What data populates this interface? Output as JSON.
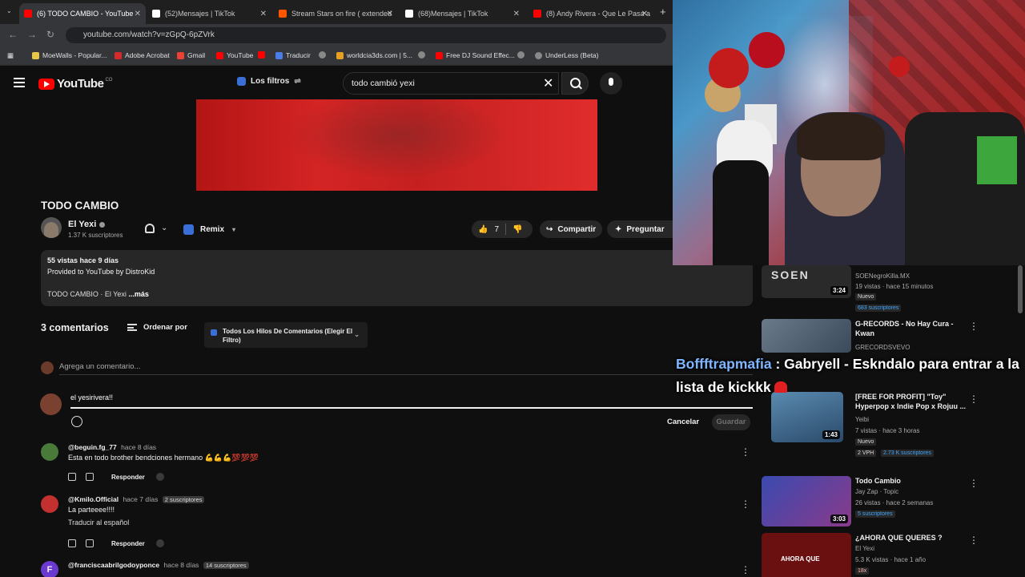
{
  "browser": {
    "tabs": [
      {
        "label": "(6) TODO CAMBIO - YouTube",
        "active": true,
        "icon": "youtube-icon",
        "color": "#ff0000"
      },
      {
        "label": "(52)Mensajes | TikTok",
        "active": false,
        "icon": "tiktok-icon",
        "color": "#ffffff"
      },
      {
        "label": "Stream Stars on fire ( extended",
        "active": false,
        "icon": "soundcloud-icon",
        "color": "#ff5500"
      },
      {
        "label": "(68)Mensajes | TikTok",
        "active": false,
        "icon": "tiktok-icon",
        "color": "#ffffff"
      },
      {
        "label": "(8) Andy Rivera - Que Le Pasa a",
        "active": false,
        "icon": "youtube-icon",
        "color": "#ff0000"
      }
    ],
    "url": "youtube.com/watch?v=zGpQ-6pZVrk",
    "bookmarks": [
      {
        "label": "MoeWalls - Popular...",
        "color": "#e8c548"
      },
      {
        "label": "Adobe Acrobat",
        "color": "#d42a2a"
      },
      {
        "label": "Gmail",
        "color": "#ea4335"
      },
      {
        "label": "YouTube",
        "color": "#ff0000"
      },
      {
        "label": "Traducir",
        "color": "#4a7de8"
      },
      {
        "label": "worldcia3ds.com | 5...",
        "color": "#e8a020"
      },
      {
        "label": "Free DJ Sound Effec...",
        "color": "#ff0000"
      },
      {
        "label": "UnderLess (Beta)",
        "color": "#888888"
      }
    ]
  },
  "header": {
    "logo": "YouTube",
    "logo_suffix": "CO",
    "filters_label": "Los filtros",
    "search_value": "todo cambió yexi"
  },
  "video": {
    "title": "TODO CAMBIO",
    "channel": "El Yexi",
    "subscribers": "1.37 K suscriptores",
    "remix_label": "Remix",
    "likes": "7",
    "share_label": "Compartir",
    "ask_label": "Preguntar"
  },
  "description": {
    "stats": "55 vistas  hace 9 días",
    "provided": "Provided to YouTube by DistroKid",
    "line": "TODO CAMBIO · El Yexi",
    "more": "...más"
  },
  "comments": {
    "count": "3 comentarios",
    "sort_label": "Ordenar por",
    "thread_filter": "Todos Los Hilos De Comentarios (Elegir El Filtro)",
    "add_placeholder": "Agrega un comentario...",
    "draft_text": "el yesirivera!!",
    "cancel_label": "Cancelar",
    "save_label": "Guardar",
    "reply_label": "Responder",
    "items": [
      {
        "author": "@beguin.fg_77",
        "time": "hace 8 días",
        "badge": "",
        "text": "Esta en todo brother bendciones hermano 💪💪💪💯💯💯",
        "translate": "",
        "avatar_color": "#4a7a3a"
      },
      {
        "author": "@Kmilo.Official",
        "time": "hace 7 días",
        "badge": "2 suscriptores",
        "text": "La parteeee!!!!",
        "translate": "Traducir al español",
        "avatar_color": "#c23030"
      },
      {
        "author": "@franciscaabrilgodoyponce",
        "time": "hace 8 días",
        "badge": "14 suscriptores",
        "text": "",
        "translate": "",
        "avatar_color": "#6a3ad0",
        "initial": "F"
      }
    ]
  },
  "sidebar": {
    "items": [
      {
        "title": "",
        "channel": "SOENegroKilla.MX",
        "meta": "19 vistas · hace 15 minutos",
        "badge": "Nuevo",
        "badge2": "683 suscriptores",
        "duration": "3:24",
        "thumb_color": "#2a2a2a"
      },
      {
        "title": "G-RECORDS - No Hay Cura - Kwan",
        "channel": "GRECORDSVEVO",
        "meta": "",
        "badge": "",
        "badge2": "",
        "duration": "",
        "thumb_color": "#3a4a5a"
      },
      {
        "title": "[FREE FOR PROFIT] \"Toy\" Hyperpop x Indie Pop x Rojuu ...",
        "channel": "Yeibi",
        "meta": "7 vistas · hace 3 horas",
        "badge": "Nuevo",
        "badge2": "2.73 K suscriptores",
        "badge_extra": "2 VPH",
        "duration": "1:43",
        "thumb_color": "#3a6a8a"
      },
      {
        "title": "Todo Cambio",
        "channel": "Jay Zap · Topic",
        "meta": "26 vistas · hace 2 semanas",
        "badge": "",
        "badge2": "5 suscriptores",
        "duration": "3:03",
        "thumb_color": "#2a3a8a"
      },
      {
        "title": "¿AHORA QUE QUERES ?",
        "channel": "El Yexi",
        "meta": "5.3 K vistas · hace 1 año",
        "badge": "18x",
        "badge2": "",
        "duration": "",
        "thumb_color": "#8a1a1a",
        "thumb_text": "AHORA QUE"
      }
    ]
  },
  "chat": {
    "user": "Boffftrapmafia",
    "message": " : Gabryell - Eskndalo para entrar a la lista de kickkk"
  }
}
